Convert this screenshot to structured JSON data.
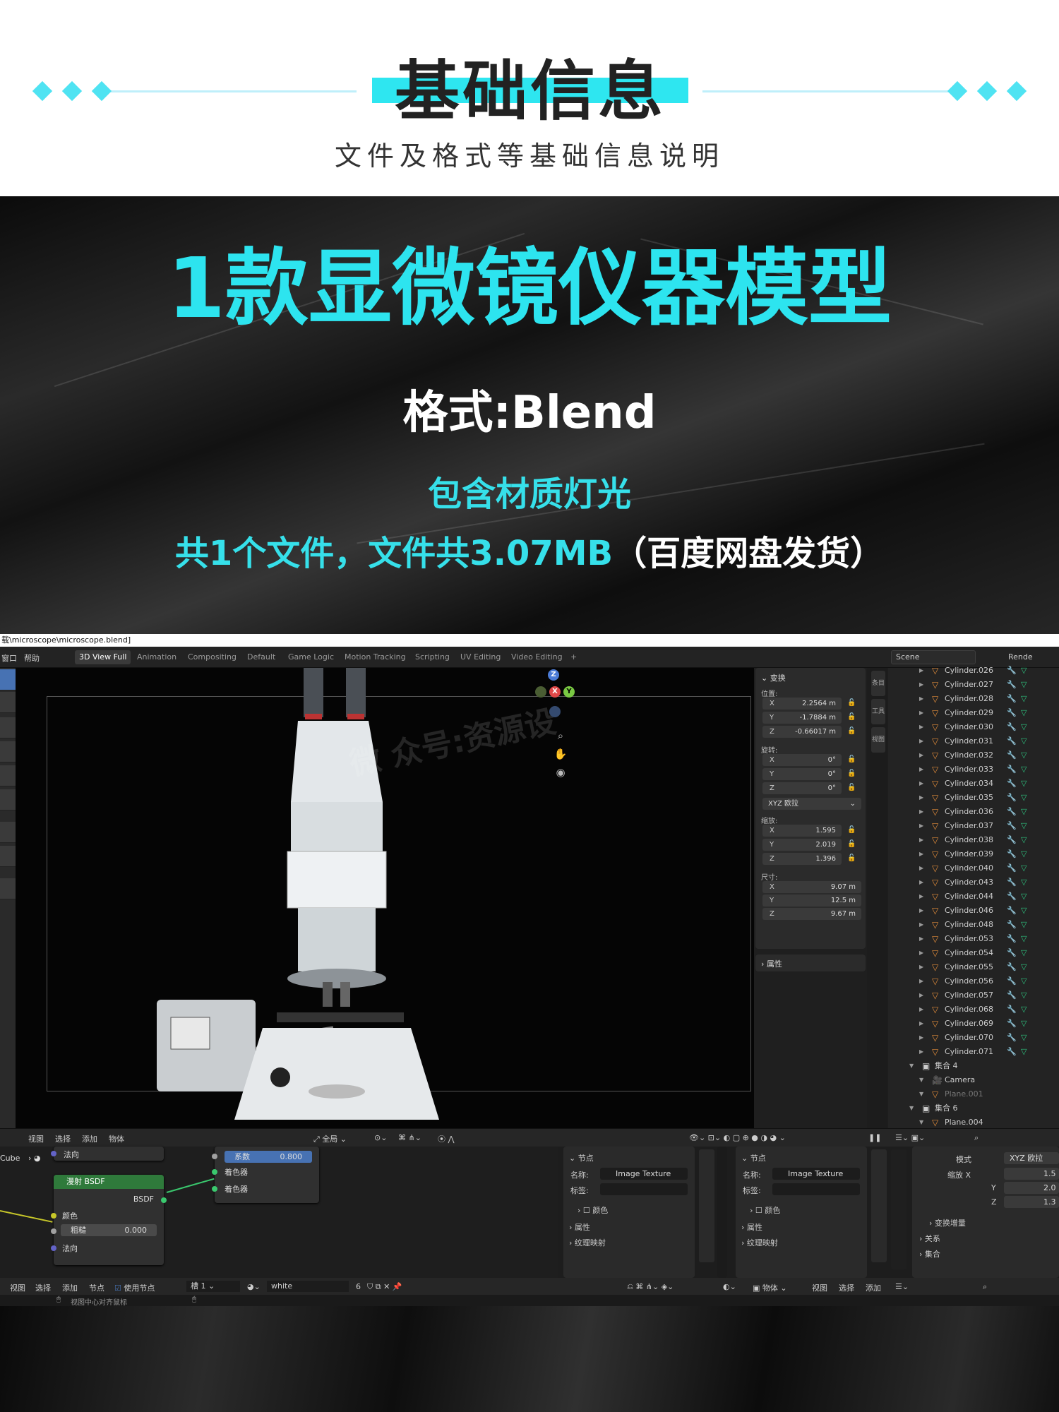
{
  "header": {
    "title": "基础信息",
    "subtitle": "文件及格式等基础信息说明"
  },
  "banner": {
    "title": "1款显微镜仪器模型",
    "format": "格式:Blend",
    "includes": "包含材质灯光",
    "files_prefix": "共1个文件，文件共3.07MB",
    "files_suffix": "（百度网盘发货）"
  },
  "blender": {
    "path": "载\\microscope\\microscope.blend]",
    "menus": [
      "窗口",
      "帮助"
    ],
    "workspace_tabs": [
      "3D View Full",
      "Animation",
      "Compositing",
      "Default",
      "Game Logic",
      "Motion Tracking",
      "Scripting",
      "UV Editing",
      "Video Editing"
    ],
    "add_tab": "+",
    "scene": "Scene",
    "render_label": "Rende",
    "watermark": "微 众号:资源设",
    "gizmo": {
      "z": "Z",
      "y": "Y",
      "x": "X"
    },
    "npanel": {
      "transform_label": "变换",
      "location_label": "位置:",
      "location": [
        {
          "axis": "X",
          "value": "2.2564 m"
        },
        {
          "axis": "Y",
          "value": "-1.7884 m"
        },
        {
          "axis": "Z",
          "value": "-0.66017 m"
        }
      ],
      "rotation_label": "旋转:",
      "rotation": [
        {
          "axis": "X",
          "value": "0°"
        },
        {
          "axis": "Y",
          "value": "0°"
        },
        {
          "axis": "Z",
          "value": "0°"
        }
      ],
      "rotation_mode": "XYZ 欧拉",
      "scale_label": "缩放:",
      "scale": [
        {
          "axis": "X",
          "value": "1.595"
        },
        {
          "axis": "Y",
          "value": "2.019"
        },
        {
          "axis": "Z",
          "value": "1.396"
        }
      ],
      "dimensions_label": "尺寸:",
      "dimensions": [
        {
          "axis": "X",
          "value": "9.07 m"
        },
        {
          "axis": "Y",
          "value": "12.5 m"
        },
        {
          "axis": "Z",
          "value": "9.67 m"
        }
      ],
      "properties_label": "属性"
    },
    "side_tabs": [
      "条目",
      "工具",
      "视图"
    ],
    "outliner": {
      "objects": [
        "Cylinder.026",
        "Cylinder.027",
        "Cylinder.028",
        "Cylinder.029",
        "Cylinder.030",
        "Cylinder.031",
        "Cylinder.032",
        "Cylinder.033",
        "Cylinder.034",
        "Cylinder.035",
        "Cylinder.036",
        "Cylinder.037",
        "Cylinder.038",
        "Cylinder.039",
        "Cylinder.040",
        "Cylinder.043",
        "Cylinder.044",
        "Cylinder.046",
        "Cylinder.048",
        "Cylinder.053",
        "Cylinder.054",
        "Cylinder.055",
        "Cylinder.056",
        "Cylinder.057",
        "Cylinder.068",
        "Cylinder.069",
        "Cylinder.070",
        "Cylinder.071"
      ],
      "collection4": "集合 4",
      "camera": "Camera",
      "plane001": "Plane.001",
      "collection6": "集合 6",
      "plane004": "Plane.004"
    },
    "viewport_header": {
      "menus": [
        "视图",
        "选择",
        "添加",
        "物体"
      ],
      "global": "全局"
    },
    "node_editor": {
      "object": "Cube",
      "material": "white",
      "normal": "法向",
      "bsdf_title": "漫射 BSDF",
      "bsdf_out": "BSDF",
      "color": "颜色",
      "roughness_label": "粗糙",
      "roughness_value": "0.000",
      "normal2": "法向",
      "mix_factor_label": "系数",
      "mix_factor_value": "0.800",
      "shader1": "着色器",
      "shader2": "着色器"
    },
    "node_props": {
      "node_label": "节点",
      "name_label": "名称:",
      "name_value": "Image Texture",
      "label_label": "标签:",
      "color_label": "颜色",
      "properties_label": "属性",
      "texture_mapping": "纹理映射"
    },
    "mapping": {
      "mode_label": "模式",
      "mode_value": "XYZ 欧拉",
      "scale_x_label": "缩放 X",
      "scale_x": "1.5",
      "y_label": "Y",
      "y": "2.0",
      "z_label": "Z",
      "z": "1.3",
      "delta": "变换增量",
      "relations": "关系",
      "collections": "集合"
    },
    "node_header": {
      "menus": [
        "视图",
        "选择",
        "添加",
        "节点"
      ],
      "use_nodes": "使用节点",
      "slot": "槽 1",
      "material": "white",
      "users": "6"
    },
    "node_header2": {
      "object": "物体",
      "menus": [
        "视图",
        "选择",
        "添加"
      ]
    },
    "status": "视图中心对齐鼠标"
  },
  "colors": {
    "accent": "#2de4ef",
    "blender_bg": "#1d1d1d",
    "active_blue": "#4772b3",
    "node_green": "#2f7a3b"
  }
}
